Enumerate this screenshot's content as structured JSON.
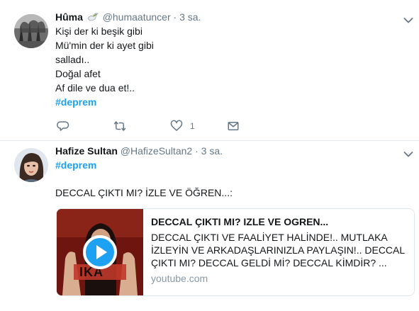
{
  "tweet1": {
    "name": "Hûma",
    "handle": "@humaatuncer",
    "separator": "·",
    "time": "3 sa.",
    "lines": [
      "Kişi der ki beşik gibi",
      "Mü'min der ki ayet gibi",
      "salladı..",
      "Doğal afet",
      "Af dile ve dua et!.."
    ],
    "hashtag": "#deprem",
    "actions": {
      "reply_count": "",
      "retweet_count": "",
      "like_count": "1",
      "dm_count": ""
    }
  },
  "tweet2": {
    "name": "Hafize Sultan",
    "handle": "@HafizeSultan2",
    "separator": "·",
    "time": "3 sa.",
    "hashtag": "#deprem",
    "text": "DECCAL ÇIKTI MI? İZLE VE ÖĞREN...:",
    "card": {
      "title": "DECCAL ÇIKTI MI? IZLE VE OGREN...",
      "description": "DECCAL ÇIKTI VE FAALİYET HALİNDE!.. MUTLAKA İZLEYİN VE ARKADAŞLARINIZLA PAYLAŞIN!.. DECCAL ÇIKTI MI? DECCAL GELDİ Mİ? DECCAL KİMDİR? ...",
      "domain": "youtube.com",
      "thumb_text": "IKA"
    }
  },
  "colors": {
    "accent": "#1da1f2",
    "muted": "#657786",
    "border": "#e6ecf0"
  },
  "icons": [
    "dove-emoji-icon",
    "chevron-down-icon",
    "reply-icon",
    "retweet-icon",
    "heart-icon",
    "direct-message-icon",
    "play-icon"
  ]
}
